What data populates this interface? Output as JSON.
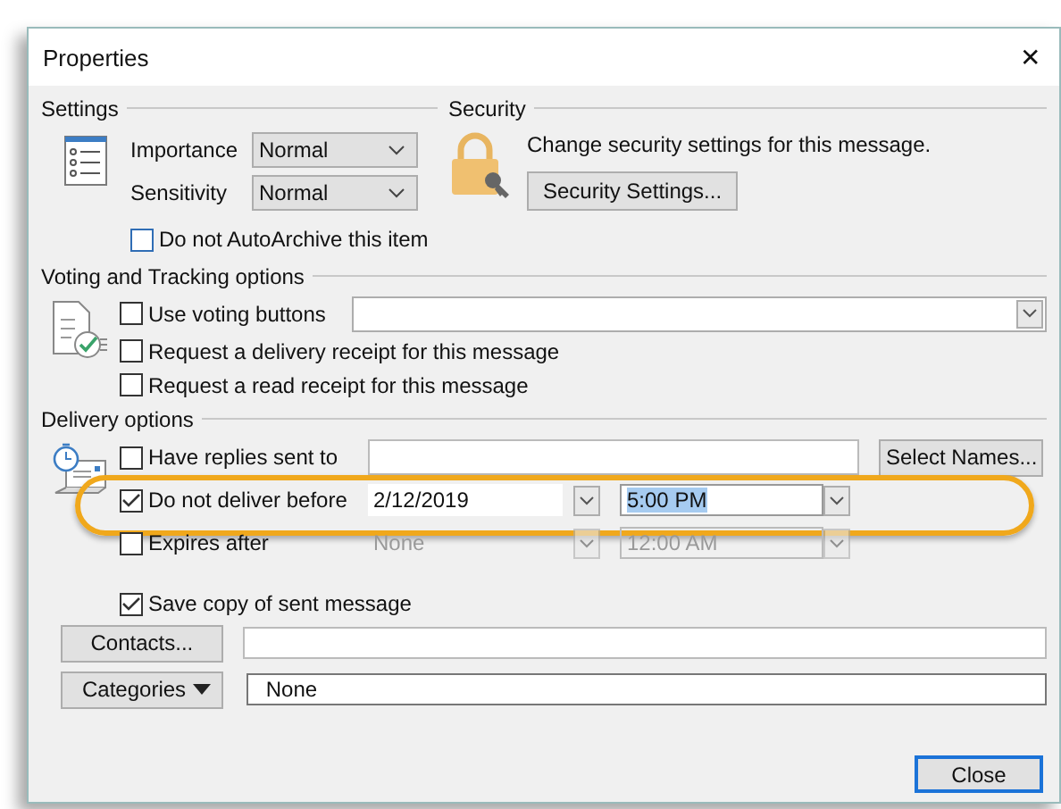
{
  "window": {
    "title": "Properties",
    "close": "✕"
  },
  "settings": {
    "heading": "Settings",
    "fields": [
      {
        "label": "Importance",
        "value": "Normal"
      },
      {
        "label": "Sensitivity",
        "value": "Normal"
      }
    ],
    "autoarchive": {
      "label": "Do not AutoArchive this item",
      "checked": false
    }
  },
  "security": {
    "heading": "Security",
    "text": "Change security settings for this message.",
    "button": "Security Settings..."
  },
  "voting": {
    "heading": "Voting and Tracking options",
    "options": [
      {
        "kind": "dropdown",
        "label": "Use voting buttons",
        "checked": false
      },
      {
        "kind": "plain",
        "label": "Request a delivery receipt for this message",
        "checked": false
      },
      {
        "kind": "plain",
        "label": "Request a read receipt for this message",
        "checked": false
      }
    ]
  },
  "delivery": {
    "heading": "Delivery options",
    "options": [
      {
        "kind": "text",
        "label": "Have replies sent to",
        "checked": false,
        "button": "Select Names..."
      },
      {
        "kind": "datetime",
        "label": "Do not deliver before",
        "checked": true,
        "disabled": false,
        "highlighted": true,
        "date": "2/12/2019",
        "time": "5:00 PM",
        "time_selected": true
      },
      {
        "kind": "datetime",
        "label": "Expires after",
        "checked": false,
        "disabled": true,
        "highlighted": false,
        "date": "None",
        "time": "12:00 AM",
        "time_selected": false
      },
      {
        "kind": "plain",
        "label": "Save copy of sent message",
        "checked": true
      }
    ]
  },
  "contacts": {
    "button": "Contacts..."
  },
  "categories": {
    "button": "Categories",
    "value": "None"
  },
  "buttons": [
    "Close"
  ]
}
